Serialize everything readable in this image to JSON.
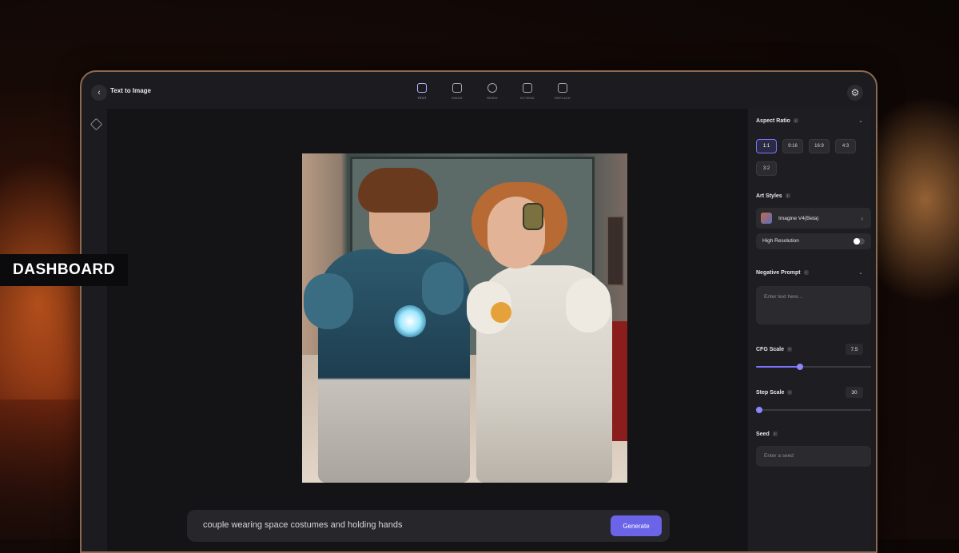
{
  "app": {
    "title": "Text to Image"
  },
  "toolbar": {
    "tools": [
      {
        "label": "TEXT",
        "icon": "text-icon",
        "active": true
      },
      {
        "label": "IMAGE",
        "icon": "image-icon",
        "active": false
      },
      {
        "label": "REMIX",
        "icon": "remix-icon",
        "active": false
      },
      {
        "label": "EXTEND",
        "icon": "extend-icon",
        "active": false
      },
      {
        "label": "REPLACE",
        "icon": "replace-icon",
        "active": false
      }
    ]
  },
  "prompt": {
    "text": "couple wearing space costumes and holding hands",
    "generate_label": "Generate"
  },
  "settings": {
    "aspect_ratio": {
      "title": "Aspect Ratio",
      "options": [
        "1:1",
        "9:16",
        "16:9",
        "4:3",
        "3:2"
      ],
      "selected": "1:1"
    },
    "art_styles": {
      "title": "Art Styles",
      "selected_style": "Imagine V4(Beta)",
      "high_resolution_label": "High Resolution",
      "high_resolution_on": false
    },
    "negative_prompt": {
      "title": "Negative Prompt",
      "placeholder": "Enter text here..."
    },
    "cfg_scale": {
      "title": "CFG Scale",
      "value": "7.5",
      "fill_fraction": 0.38
    },
    "step_scale": {
      "title": "Step Scale",
      "value": "30",
      "fill_fraction": 0.02
    },
    "seed": {
      "title": "Seed",
      "placeholder": "Enter a seed"
    }
  },
  "overlay_label": "DASHBOARD",
  "colors": {
    "accent": "#6b63e8",
    "panel_bg": "#1e1e22",
    "canvas_bg": "#141417"
  }
}
